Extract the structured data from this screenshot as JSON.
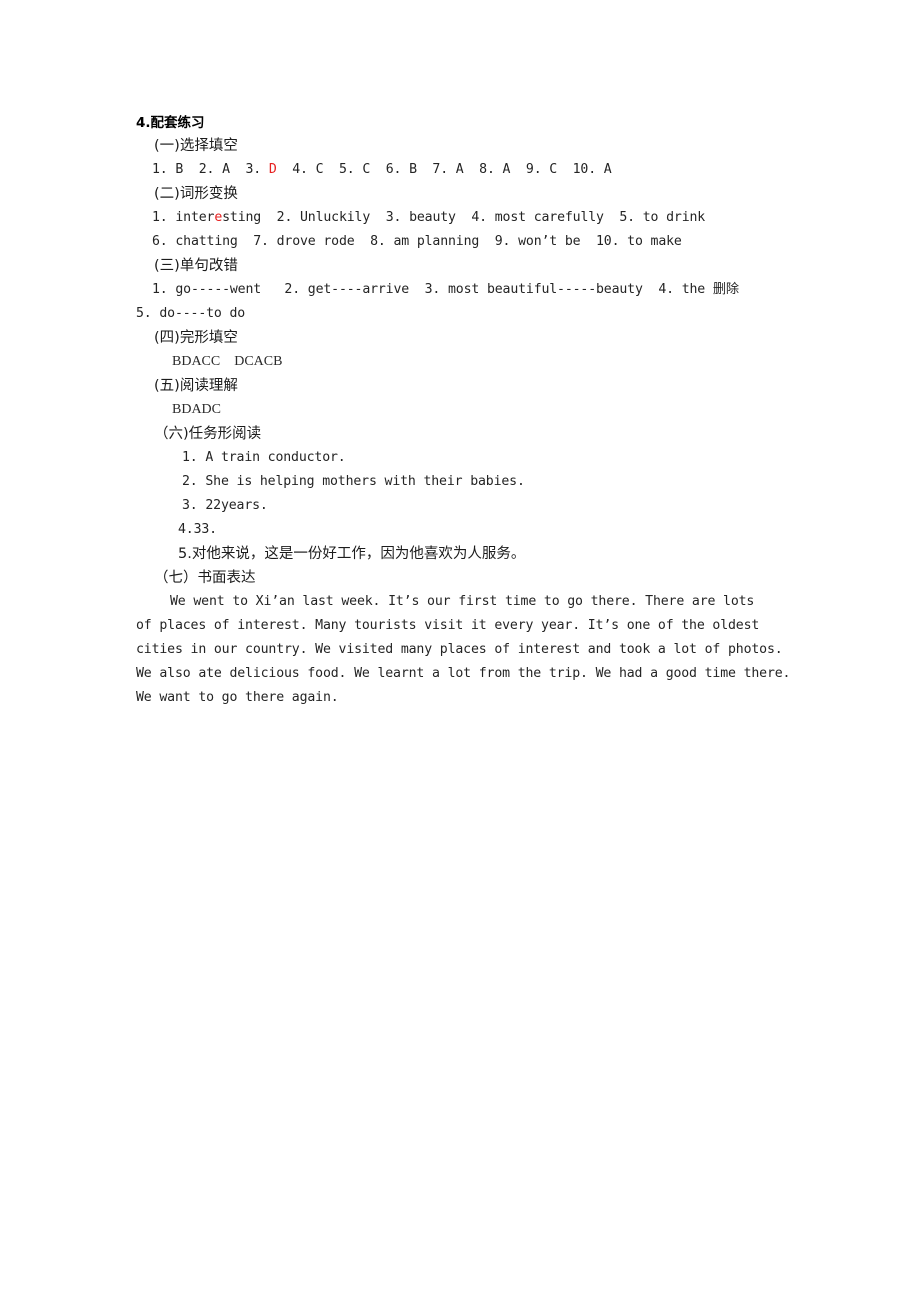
{
  "document": {
    "heading": "4.配套练习",
    "sections": [
      {
        "id": "section-1",
        "label": "(一)选择填空",
        "lines": [
          {
            "id": "mc-answers",
            "segments": [
              {
                "text": "1. B  2. A  3. ",
                "color": "normal"
              },
              {
                "text": "D",
                "color": "red"
              },
              {
                "text": "  4. C  5. C  6. B  7. A  8. A  9. C  10. A",
                "color": "normal"
              }
            ]
          }
        ]
      },
      {
        "id": "section-2",
        "label": "(二)词形变换",
        "lines": [
          {
            "id": "wordform-line-1",
            "segments": [
              {
                "text": "1. inter",
                "color": "normal"
              },
              {
                "text": "e",
                "color": "red"
              },
              {
                "text": "sting  2. Unluckily  3. beauty  4. most carefully  5. to drink",
                "color": "normal"
              }
            ]
          },
          {
            "id": "wordform-line-2",
            "segments": [
              {
                "text": "6. chatting  7. drove rode  8. am planning  9. won’t be  10. to make",
                "color": "normal"
              }
            ]
          }
        ]
      },
      {
        "id": "section-3",
        "label": "(三)单句改错",
        "lines": [
          {
            "id": "correction-line-1",
            "segments": [
              {
                "text": "1. go-----went   2. get----arrive  3. most beautiful-----beauty  4. the 删除",
                "color": "normal"
              }
            ]
          },
          {
            "id": "correction-line-2",
            "segments": [
              {
                "text": "5. do----to do",
                "color": "normal"
              }
            ]
          }
        ]
      },
      {
        "id": "section-4",
        "label": "(四)完形填空",
        "answer_key": "BDACC    DCACB"
      },
      {
        "id": "section-5",
        "label": "(五)阅读理解",
        "answer_key": "BDADC"
      },
      {
        "id": "section-6",
        "label": "（六)任务形阅读",
        "items": [
          "1. A train conductor.",
          "2. She is helping mothers with their babies.",
          "3. 22years.",
          "4.33.",
          "5.对他来说，这是一份好工作，因为他喜欢为人服务。"
        ]
      },
      {
        "id": "section-7",
        "label": "（七）书面表达",
        "essay_lines": [
          "We went to Xi’an last week. It’s our first time to go there. There are lots",
          "of places of interest. Many tourists visit it every year. It’s one of the oldest",
          "cities in our country. We visited many places of interest and took a lot of photos.",
          "We also ate delicious food. We learnt a lot from the trip. We had a good time there.",
          "We want to go there again."
        ]
      }
    ]
  },
  "colors": {
    "page_background": "#ffffff",
    "body_text": "#242424",
    "highlight_red": "#e62020"
  }
}
